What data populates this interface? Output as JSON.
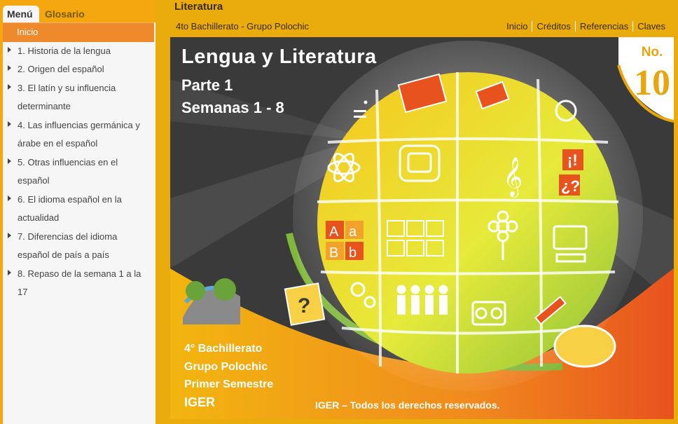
{
  "sidebar": {
    "tabs": [
      "Menú",
      "Glosario"
    ],
    "items": [
      {
        "label": "Inicio"
      },
      {
        "label": "1. Historia de la lengua"
      },
      {
        "label": "2. Origen del español"
      },
      {
        "label": "3. El latín y su influencia determinante"
      },
      {
        "label": "4. Las influencias germánica y árabe en el español"
      },
      {
        "label": "5. Otras influencias en el español"
      },
      {
        "label": "6. El idioma español en la actualidad"
      },
      {
        "label": "7. Diferencias del idioma español de país a país"
      },
      {
        "label": "8. Repaso de la semana 1 a la 17"
      }
    ]
  },
  "header": {
    "title": "Literatura",
    "subtitle": "4to Bachillerato - Grupo Polochic",
    "nav": [
      "Inicio",
      "Créditos",
      "Referencias",
      "Claves"
    ]
  },
  "cover": {
    "title": "Lengua  y Literatura",
    "part": "Parte 1",
    "weeks": "Semanas 1 - 8",
    "badge_no": "No.",
    "badge_num": "10",
    "grade": "4° Bachillerato",
    "group": "Grupo Polochic",
    "semester": "Primer Semestre",
    "org": "IGER",
    "rights": "IGER – Todos los derechos reservados.",
    "tile_icons": [
      "math-icon",
      "book-icon",
      "blocks-icon",
      "hands-icon",
      "atom-icon",
      "mayan-glyph-icon",
      "music-icon",
      "punctuation-icon",
      "letters-icon",
      "numbers-icon",
      "flower-icon",
      "computer-icon",
      "gears-icon",
      "people-icon",
      "radio-icon",
      "pencil-icon",
      "map-icon",
      "question-book-icon",
      "landscape-icon"
    ]
  },
  "colors": {
    "accent": "#ee8a2b",
    "background": "#e9ac0c",
    "sidebar": "#f6f6f6"
  }
}
